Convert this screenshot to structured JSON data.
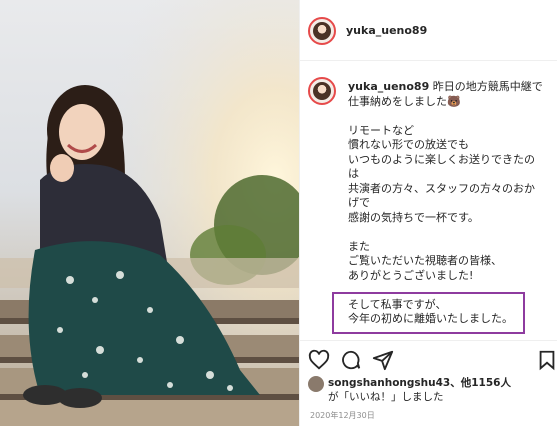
{
  "post": {
    "username": "yuka_ueno89",
    "caption_author": "yuka_ueno89",
    "caption_line1": "昨日の地方競馬中継で",
    "caption_line2": "仕事納めをしました",
    "caption_emoji": "🐻",
    "lines": [
      "リモートなど",
      "慣れない形での放送でも",
      "いつものように楽しくお送りできたの",
      "は",
      "共演者の方々、スタッフの方々のおか",
      "げで",
      "感謝の気持ちで一杯です。",
      "",
      "また",
      "ご覧いただいた視聴者の皆様、",
      "ありがとうございました!",
      "",
      "そして私事ですが、",
      "今年の初めに離婚いたしました。"
    ],
    "likes_text": "songshanhongshu43、他1156人",
    "likes_suffix": "が「いいね！」しました",
    "date": "2020年12月30日"
  },
  "colors": {
    "highlight_border": "#8e3b9f",
    "avatar_ring": "#e64a4a"
  },
  "icons": [
    "heart-icon",
    "comment-icon",
    "share-icon",
    "bookmark-icon"
  ]
}
